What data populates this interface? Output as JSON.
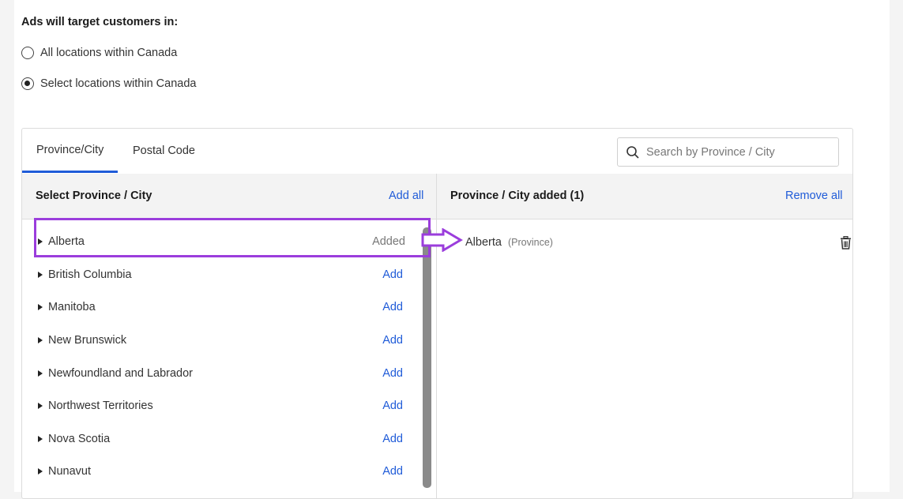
{
  "targeting": {
    "heading": "Ads will target customers in:",
    "options": [
      {
        "label": "All locations within Canada",
        "selected": false
      },
      {
        "label": "Select locations within Canada",
        "selected": true
      }
    ]
  },
  "tabs": [
    {
      "label": "Province/City",
      "active": true
    },
    {
      "label": "Postal Code",
      "active": false
    }
  ],
  "search": {
    "placeholder": "Search by Province / City"
  },
  "left_column": {
    "title": "Select Province / City",
    "add_all": "Add all",
    "items": [
      {
        "label": "Alberta",
        "action": "Added"
      },
      {
        "label": "British Columbia",
        "action": "Add"
      },
      {
        "label": "Manitoba",
        "action": "Add"
      },
      {
        "label": "New Brunswick",
        "action": "Add"
      },
      {
        "label": "Newfoundland and Labrador",
        "action": "Add"
      },
      {
        "label": "Northwest Territories",
        "action": "Add"
      },
      {
        "label": "Nova Scotia",
        "action": "Add"
      },
      {
        "label": "Nunavut",
        "action": "Add"
      }
    ]
  },
  "right_column": {
    "title": "Province / City added (1)",
    "remove_all": "Remove all",
    "items": [
      {
        "label": "Alberta",
        "type": "(Province)"
      }
    ]
  },
  "colors": {
    "link": "#1f5bd8",
    "highlight": "#9b3ddc"
  }
}
